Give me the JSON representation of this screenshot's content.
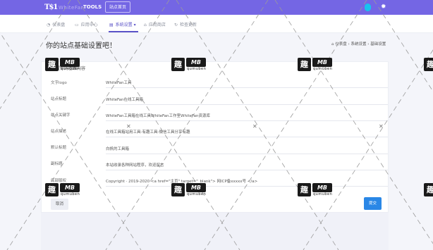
{
  "topbar": {
    "logo_mark": "T$1",
    "logo_name": "WhiteFan",
    "logo_tools": "TOOLS",
    "front_button": "站点首页"
  },
  "nav": {
    "items": [
      {
        "label": "仪表盘",
        "icon": "dashboard-icon"
      },
      {
        "label": "应用中心",
        "icon": "apps-icon"
      },
      {
        "label": "系统设置",
        "icon": "settings-icon"
      },
      {
        "label": "应用商店",
        "icon": "store-icon"
      },
      {
        "label": "检查更新",
        "icon": "refresh-icon"
      }
    ],
    "active_caret": "▾"
  },
  "page": {
    "title": "你的站点基础设置吧！",
    "breadcrumb": [
      "仪表盘",
      "系统设置",
      "基础设置"
    ]
  },
  "form": {
    "title": "设置你的基本内容",
    "rows": [
      {
        "label": "文字logo",
        "value": "WhiteFan工具"
      },
      {
        "label": "站点标题",
        "value": "WhiteFan在线工具箱"
      },
      {
        "label": "站点关键字",
        "value": "WhiteFan工具箱在线工具WhiteFan工作室WhiteFan资源库"
      },
      {
        "label": "站点描述",
        "value": "在线工具箱站用工具-有趣工具-微信工具分享有趣"
      },
      {
        "label": "默认标题",
        "value": "白帆的工具箱"
      },
      {
        "label": "副标题",
        "value": "本站收录各种网站程序，欢迎留言"
      },
      {
        "label": "底部版权",
        "value": "Copyright · 2019-2020 <a href=\"主页\" target=\"_blank\"> 网ICP备xxxxx号 </a>"
      }
    ],
    "cancel_label": "取消",
    "submit_label": "提交"
  },
  "watermark": {
    "glyph": "趣",
    "badge": "MB",
    "text": "qumuben"
  },
  "colors": {
    "topbar": "#7466e4",
    "accent": "#5a52c7",
    "submit": "#2a87e6",
    "avatar": "#18c3ee"
  }
}
